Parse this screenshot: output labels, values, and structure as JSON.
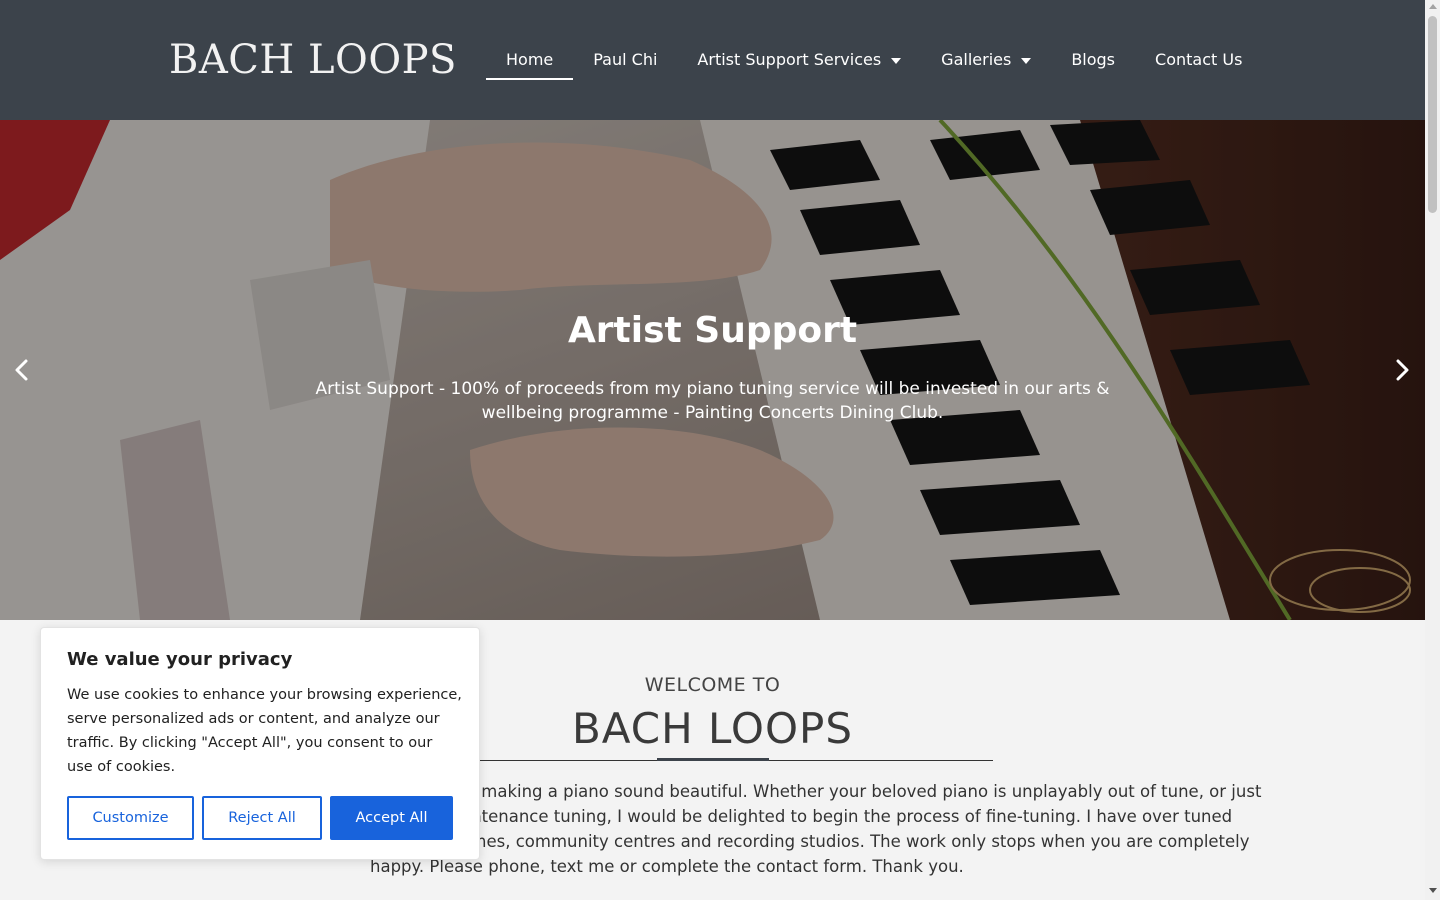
{
  "header": {
    "logo": "BACH LOOPS",
    "nav": [
      {
        "label": "Home",
        "active": true,
        "dropdown": false
      },
      {
        "label": "Paul Chi",
        "active": false,
        "dropdown": false
      },
      {
        "label": "Artist Support Services",
        "active": false,
        "dropdown": true
      },
      {
        "label": "Galleries",
        "active": false,
        "dropdown": true
      },
      {
        "label": "Blogs",
        "active": false,
        "dropdown": false
      },
      {
        "label": "Contact Us",
        "active": false,
        "dropdown": false
      }
    ]
  },
  "hero": {
    "title": "Artist Support",
    "text": "Artist Support - 100% of proceeds from my piano tuning service will be invested in our arts & wellbeing programme - Painting Concerts Dining Club.",
    "prev_icon": "chevron-left-icon",
    "next_icon": "chevron-right-icon"
  },
  "welcome": {
    "small": "WELCOME TO",
    "big": "BACH LOOPS",
    "body": "I really enjoy making a piano sound beautiful. Whether your beloved piano is unplayably out of tune, or just needs a maintenance tuning, I would be delighted to begin the process of fine-tuning. I have over tuned pianos in homes, community centres and recording studios. The work only stops when you are completely happy. Please phone, text me or complete the contact form. Thank you."
  },
  "cookie": {
    "title": "We value your privacy",
    "text": "We use cookies to enhance your browsing experience, serve personalized ads or content, and analyze our traffic. By clicking \"Accept All\", you consent to our use of cookies.",
    "customize": "Customize",
    "reject": "Reject All",
    "accept": "Accept All"
  },
  "colors": {
    "header_bg": "#3c434b",
    "accent": "#1863dc",
    "page_bg": "#f3f3f3"
  }
}
